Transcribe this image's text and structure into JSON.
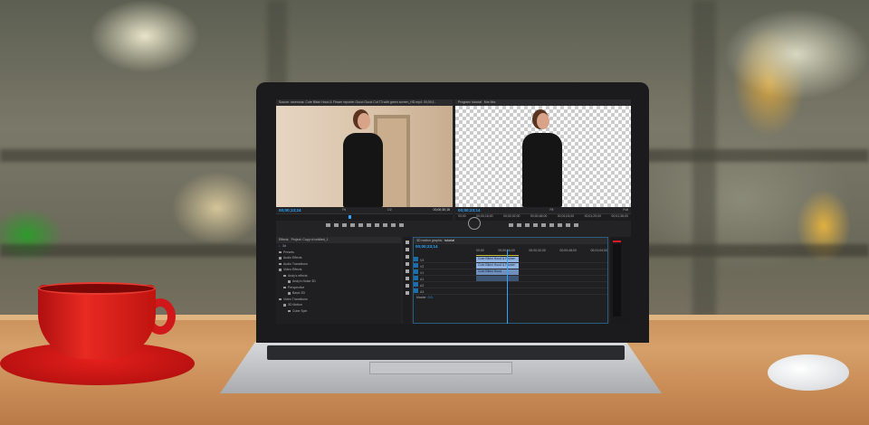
{
  "source_panel": {
    "title": "Source: ravenous: Cute Bikini Hood & Flower reporter Gucci Gucci Cut T3 with green screen_HD.mp4: 00;00;1-",
    "timecode": "00;00;13;24",
    "zoom": "Fit",
    "resolution": "1/2",
    "duration": "00;00;30;15"
  },
  "program_panel": {
    "title": "Program: tutorial",
    "tab2": "Mrs Mrs",
    "timecode": "00;00;23;14",
    "zoom": "Fit",
    "resolution": "Full",
    "ruler": [
      "00;00",
      "00;00;16;00",
      "00;00;32;00",
      "00;00;48;00",
      "00;01;04;00",
      "00;01;20;00",
      "00;01;36;00"
    ]
  },
  "effects_panel": {
    "tabs": [
      "Effects",
      "Project: Copy of untitled_1"
    ],
    "search": "3d",
    "items": [
      {
        "label": "Presets",
        "level": 0
      },
      {
        "label": "Audio Effects",
        "level": 0
      },
      {
        "label": "Audio Transitions",
        "level": 0
      },
      {
        "label": "Video Effects",
        "level": 0
      },
      {
        "label": "Andy's effects",
        "level": 1
      },
      {
        "label": "Andy's Noise 3D",
        "level": 2
      },
      {
        "label": "Perspective",
        "level": 1
      },
      {
        "label": "Basic 3D",
        "level": 2
      },
      {
        "label": "Video Transitions",
        "level": 0
      },
      {
        "label": "3D Motion",
        "level": 1
      },
      {
        "label": "Cube Spin",
        "level": 2
      }
    ]
  },
  "timeline": {
    "tabs": [
      "3D motion graphic",
      "tutorial"
    ],
    "timecode": "00;00;23;14",
    "ruler": [
      "00;00",
      "00;00;16;00",
      "00;00;32;00",
      "00;00;48;00",
      "00;01;04;00",
      "00;01;20;00",
      "00;01;36;00"
    ],
    "tracks": [
      "V3",
      "V2",
      "V1",
      "A1",
      "A2",
      "A3"
    ],
    "clips": [
      "Cute Bikini Hood & Flower",
      "Cute Bikini Hood & Flower",
      "Cute Bikini Hood"
    ],
    "master_label": "Master",
    "master_value": "0.0"
  },
  "colors": {
    "accent": "#2ea6ff",
    "cup": "#d8181a",
    "panel_bg": "#232325"
  }
}
